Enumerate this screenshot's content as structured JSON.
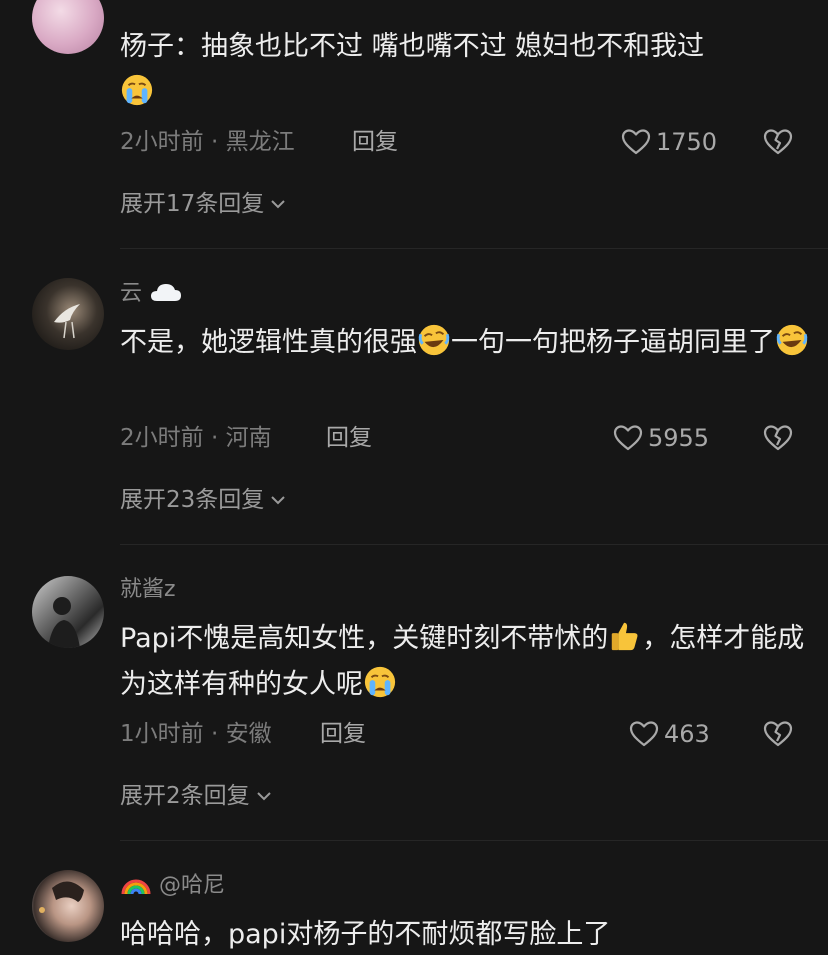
{
  "comments": [
    {
      "username": "",
      "text": "杨子：抽象也比不过 嘴也嘴不过 媳妇也不和我过",
      "emoji_after": "loudly-crying",
      "time": "2小时前",
      "location": "黑龙江",
      "reply_label": "回复",
      "likes": "1750",
      "expand_label": "展开17条回复"
    },
    {
      "username": "云",
      "username_icon": "cloud",
      "text_part1": "不是，她逻辑性真的很强",
      "text_part2": "一句一句把杨子逼胡同里了",
      "emoji_inline": "rolling-laughing",
      "time": "2小时前",
      "location": "河南",
      "reply_label": "回复",
      "likes": "5955",
      "expand_label": "展开23条回复"
    },
    {
      "username": "就酱z",
      "text_part1": "Papi不愧是高知女性，关键时刻不带怵的",
      "text_part2": "，怎样才能成为这样有种的女人呢",
      "emoji_inline": "thumbs-up",
      "emoji_after": "loudly-crying",
      "time": "1小时前",
      "location": "安徽",
      "reply_label": "回复",
      "likes": "463",
      "expand_label": "展开2条回复"
    },
    {
      "username": "@哈尼",
      "username_icon": "rainbow",
      "text": "哈哈哈，papi对杨子的不耐烦都写脸上了"
    }
  ],
  "meta_separator": " · ",
  "colors": {
    "background": "#161616",
    "text": "#ededed",
    "muted": "#7c7c7c"
  }
}
